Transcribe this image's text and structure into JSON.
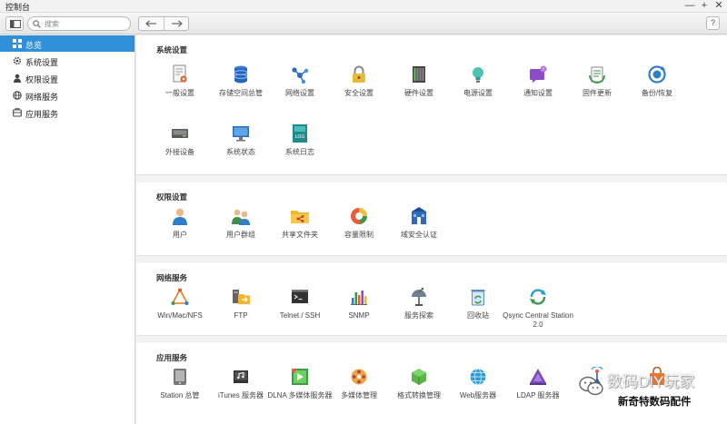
{
  "window": {
    "title": "控制台"
  },
  "toolbar": {
    "search_placeholder": "搜索",
    "help_label": "?"
  },
  "window_controls": {
    "minimize": "—",
    "maximize": "+",
    "close": "✕"
  },
  "sidebar": {
    "items": [
      {
        "label": "总览",
        "icon": "grid-icon",
        "active": true
      },
      {
        "label": "系统设置",
        "icon": "gear-icon",
        "active": false
      },
      {
        "label": "权限设置",
        "icon": "user-icon",
        "active": false
      },
      {
        "label": "网络服务",
        "icon": "globe-icon",
        "active": false
      },
      {
        "label": "应用服务",
        "icon": "app-icon",
        "active": false
      }
    ]
  },
  "sections": {
    "system": {
      "title": "系统设置",
      "tiles": [
        {
          "label": "一般设置",
          "icon": "settings-sheet-icon"
        },
        {
          "label": "存储空间总管",
          "icon": "storage-icon"
        },
        {
          "label": "网络设置",
          "icon": "network-icon"
        },
        {
          "label": "安全设置",
          "icon": "lock-icon"
        },
        {
          "label": "硬件设置",
          "icon": "hardware-icon"
        },
        {
          "label": "电源设置",
          "icon": "power-bulb-icon"
        },
        {
          "label": "通知设置",
          "icon": "notification-icon"
        },
        {
          "label": "固件更新",
          "icon": "firmware-icon"
        },
        {
          "label": "备份/恢复",
          "icon": "backup-icon"
        },
        {
          "label": "外接设备",
          "icon": "external-device-icon"
        },
        {
          "label": "系统状态",
          "icon": "monitor-icon"
        },
        {
          "label": "系统日志",
          "icon": "log-icon"
        }
      ]
    },
    "permission": {
      "title": "权限设置",
      "tiles": [
        {
          "label": "用户",
          "icon": "user-icon"
        },
        {
          "label": "用户群组",
          "icon": "user-group-icon"
        },
        {
          "label": "共享文件夹",
          "icon": "shared-folder-icon"
        },
        {
          "label": "容量限制",
          "icon": "quota-icon"
        },
        {
          "label": "域安全认证",
          "icon": "domain-security-icon"
        }
      ]
    },
    "network": {
      "title": "网络服务",
      "tiles": [
        {
          "label": "Win/Mac/NFS",
          "icon": "win-mac-nfs-icon"
        },
        {
          "label": "FTP",
          "icon": "ftp-icon"
        },
        {
          "label": "Telnet / SSH",
          "icon": "terminal-icon"
        },
        {
          "label": "SNMP",
          "icon": "snmp-icon"
        },
        {
          "label": "服务探索",
          "icon": "service-discovery-icon"
        },
        {
          "label": "回收站",
          "icon": "recycle-bin-icon"
        },
        {
          "label": "Qsync Central Station 2.0",
          "icon": "qsync-icon"
        }
      ]
    },
    "apps": {
      "title": "应用服务",
      "tiles": [
        {
          "label": "Station 总管",
          "icon": "station-manager-icon"
        },
        {
          "label": "iTunes 服务器",
          "icon": "itunes-icon"
        },
        {
          "label": "DLNA 多媒体服务器",
          "icon": "dlna-icon"
        },
        {
          "label": "多媒体管理",
          "icon": "multimedia-icon"
        },
        {
          "label": "格式转换管理",
          "icon": "transcode-icon"
        },
        {
          "label": "Web服务器",
          "icon": "web-server-icon"
        },
        {
          "label": "LDAP 服务器",
          "icon": "ldap-icon"
        },
        {
          "label": "",
          "icon": "antenna-icon"
        },
        {
          "label": "",
          "icon": "bag-icon"
        }
      ]
    }
  },
  "watermark": {
    "line1": "数码DIY玩家",
    "line2": "新奇特数码配件"
  },
  "colors": {
    "active_sidebar": "#2f8fd8",
    "section_bg": "#ffffff",
    "content_bg": "#f3f3f3"
  }
}
